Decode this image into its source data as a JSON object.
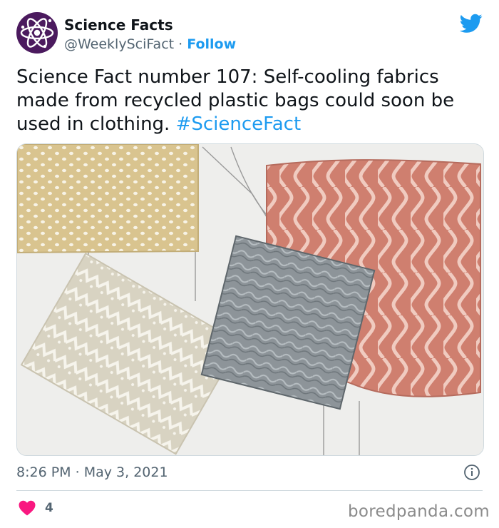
{
  "author": {
    "display_name": "Science Facts",
    "handle": "@WeeklySciFact",
    "separator": "·",
    "follow_label": "Follow",
    "avatar_icon": "atom-icon",
    "avatar_color": "#4b1a5e"
  },
  "platform_icon": "twitter-bird-icon",
  "tweet": {
    "text": "Science Fact number 107: Self-cooling fabrics made from recycled plastic bags could soon be used in clothing.",
    "hashtag": "#ScienceFact",
    "media_description_icon": "knitted-fabric-samples-image"
  },
  "meta": {
    "time": "8:26 PM",
    "separator": "·",
    "date": "May 3, 2021",
    "info_icon": "info-icon"
  },
  "engagement": {
    "like_icon": "heart-icon",
    "like_count": "4"
  },
  "watermark": "boredpanda.com",
  "colors": {
    "accent": "#1d9bf0",
    "heart": "#f91880",
    "secondary_text": "#536471"
  }
}
